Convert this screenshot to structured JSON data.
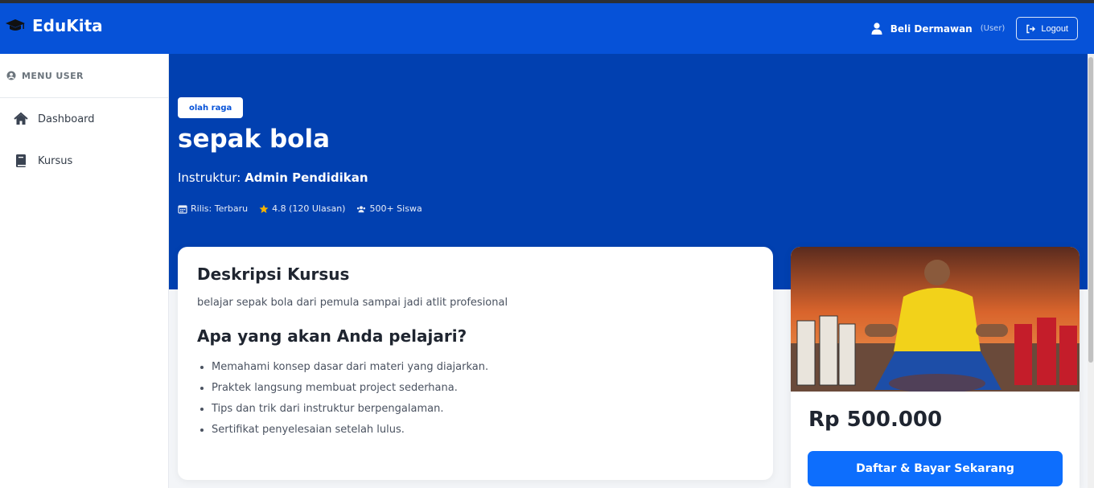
{
  "navbar": {
    "brand": "EduKita",
    "user_name": "Beli Dermawan",
    "user_role": "(User)",
    "logout_label": "Logout"
  },
  "sidebar": {
    "header": "MENU USER",
    "items": [
      {
        "label": "Dashboard",
        "icon": "home-icon"
      },
      {
        "label": "Kursus",
        "icon": "book-icon"
      }
    ]
  },
  "course": {
    "category": "olah raga",
    "title": "sepak bola",
    "instructor_label": "Instruktur:",
    "instructor_name": "Admin Pendidikan",
    "release": "Rilis: Terbaru",
    "rating": "4.8 (120 Ulasan)",
    "students": "500+ Siswa"
  },
  "description": {
    "heading": "Deskripsi Kursus",
    "text": "belajar sepak bola dari pemula sampai jadi atlit profesional",
    "learn_heading": "Apa yang akan Anda pelajari?",
    "learn_items": [
      "Memahami konsep dasar dari materi yang diajarkan.",
      "Praktek langsung membuat project sederhana.",
      "Tips dan trik dari instruktur berpengalaman.",
      "Sertifikat penyelesaian setelah lulus."
    ]
  },
  "purchase": {
    "price": "Rp 500.000",
    "button_label": "Daftar & Bayar Sekarang"
  },
  "colors": {
    "navbar": "#0652d8",
    "hero": "#0140b0",
    "primary_button": "#0d6efd",
    "rating_star": "#f5b301"
  }
}
